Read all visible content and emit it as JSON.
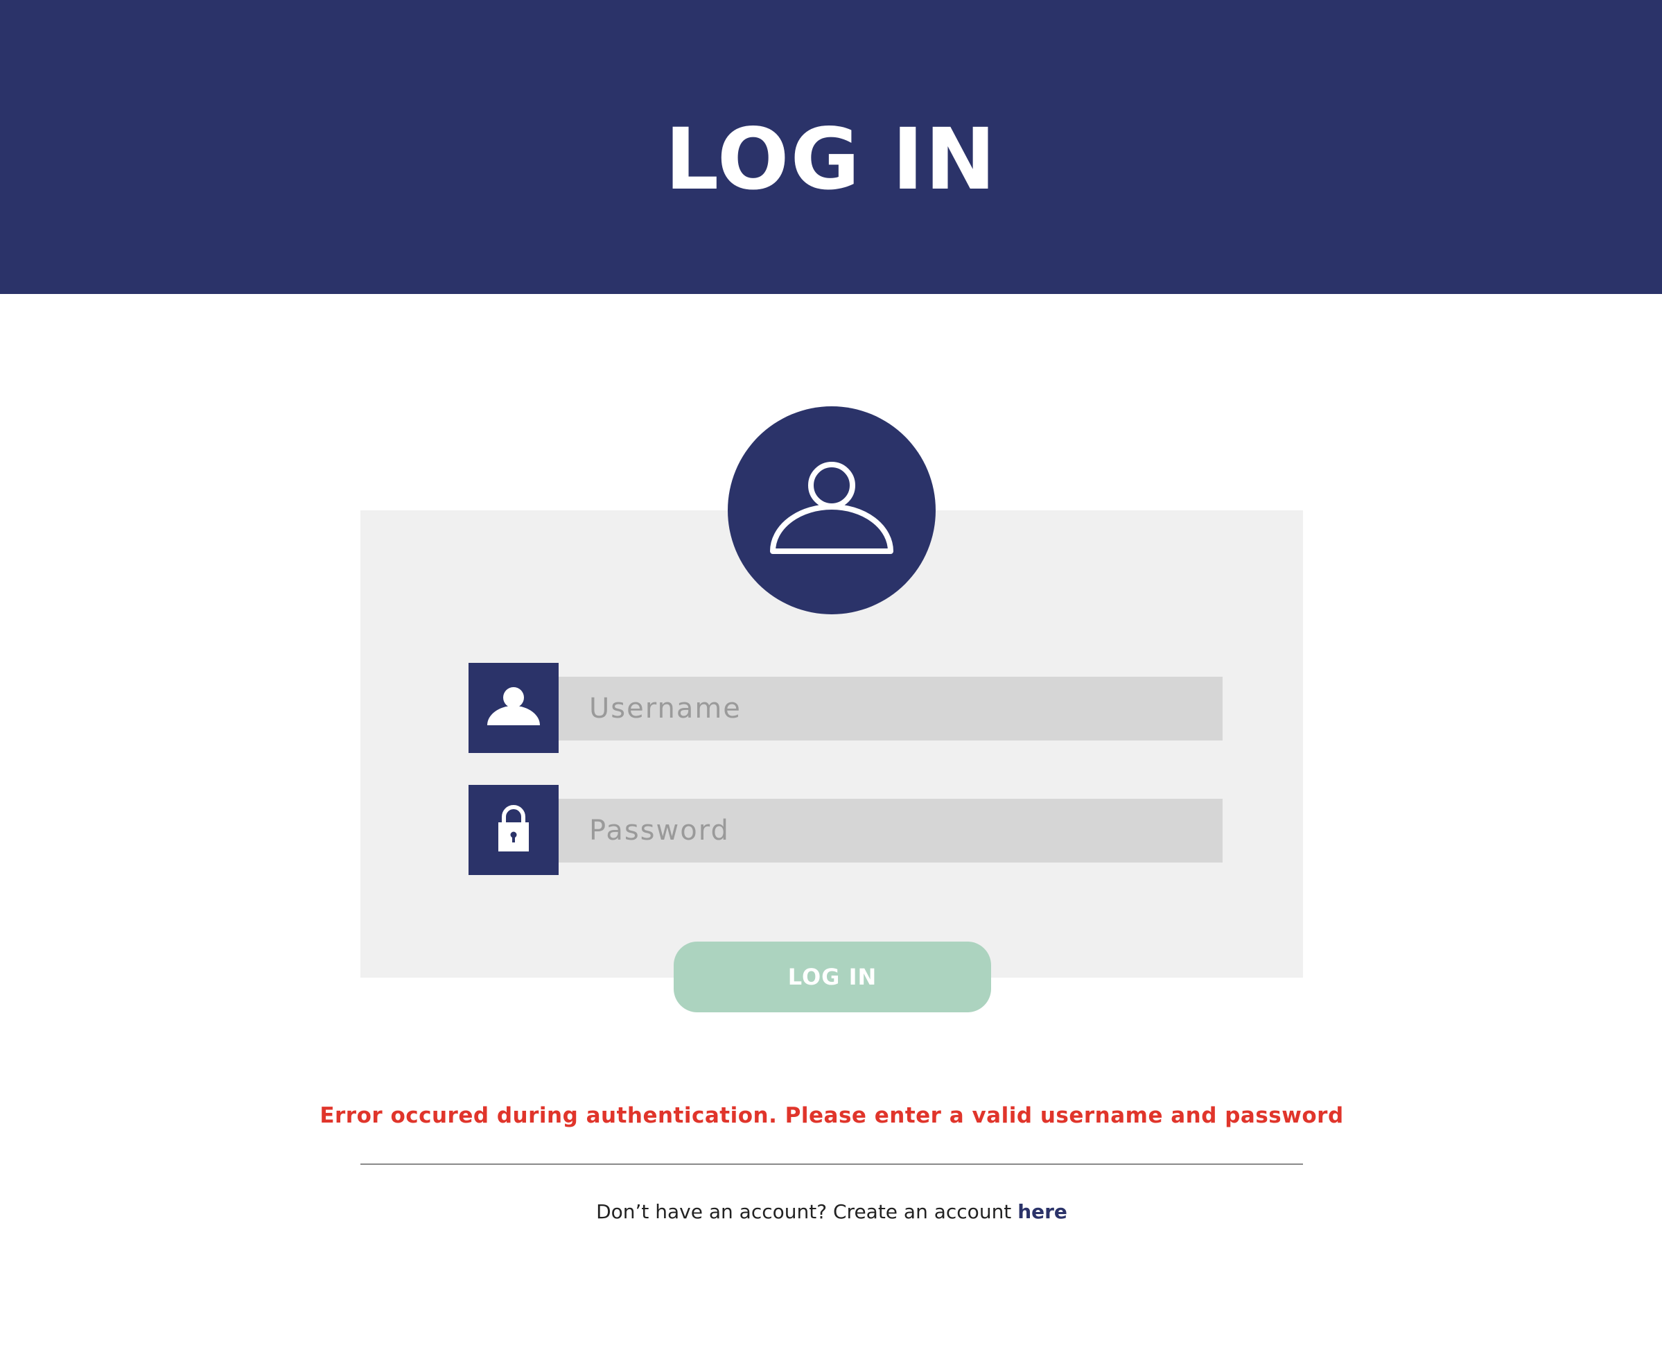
{
  "header": {
    "title": "LOG IN"
  },
  "form": {
    "avatar_icon": "user-outline-icon",
    "username": {
      "icon": "user-icon",
      "placeholder": "Username",
      "value": ""
    },
    "password": {
      "icon": "lock-icon",
      "placeholder": "Password",
      "value": ""
    },
    "submit_label": "LOG IN"
  },
  "error": {
    "message": "Error occured during authentication. Please enter a valid username and password"
  },
  "signup": {
    "prompt": "Don’t have an account? Create an account ",
    "link_label": "here"
  },
  "colors": {
    "brand_navy": "#2b3369",
    "card_bg": "#f0f0f0",
    "input_bg": "#d6d6d6",
    "button_green": "#acd3bf",
    "error_red": "#e0352b"
  }
}
